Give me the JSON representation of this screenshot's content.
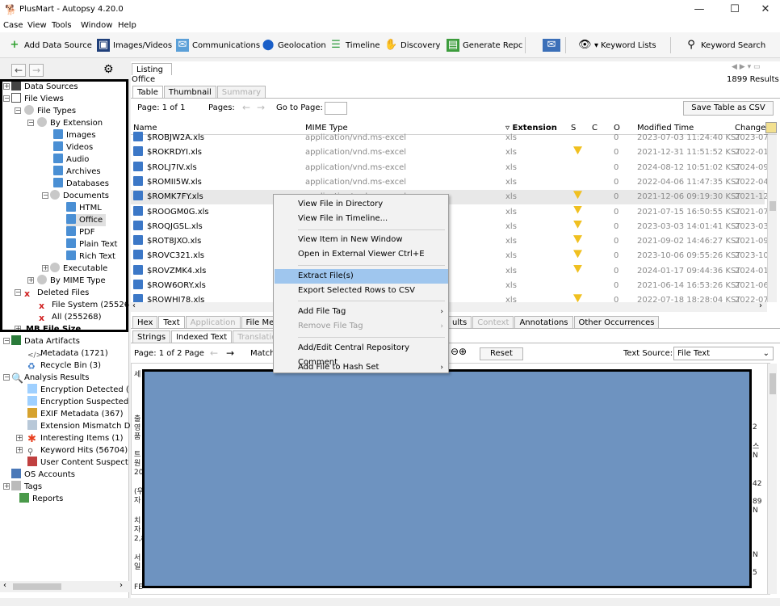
{
  "window": {
    "title": "PlusMart - Autopsy 4.20.0",
    "minimize": "—",
    "maximize": "☐",
    "close": "✕"
  },
  "menu": [
    "Case",
    "View",
    "Tools",
    "Window",
    "Help"
  ],
  "toolbar": {
    "add_data_source": "Add Data Source",
    "images_videos": "Images/Videos",
    "communications": "Communications",
    "geolocation": "Geolocation",
    "timeline": "Timeline",
    "discovery": "Discovery",
    "generate_report": "Generate Repc",
    "keyword_lists": "Keyword Lists",
    "keyword_search": "Keyword Search"
  },
  "tree": {
    "data_sources": "Data Sources",
    "file_views": "File Views",
    "file_types": "File Types",
    "by_extension": "By Extension",
    "images": "Images",
    "videos": "Videos",
    "audio": "Audio",
    "archives": "Archives",
    "databases": "Databases",
    "documents": "Documents",
    "html": "HTML",
    "office": "Office",
    "pdf": "PDF",
    "plain_text": "Plain Text",
    "rich_text": "Rich Text",
    "executable": "Executable",
    "by_mime_type": "By MIME Type",
    "deleted_files": "Deleted Files",
    "file_system": "File System (25526",
    "all": "All (255268)",
    "mb_file_size": "MB File Size",
    "data_artifacts": "Data Artifacts",
    "metadata": "Metadata (1721)",
    "recycle_bin": "Recycle Bin (3)",
    "analysis_results": "Analysis Results",
    "encryption_detected": "Encryption Detected (",
    "encryption_suspected": "Encryption Suspected",
    "exif_metadata": "EXIF Metadata (367)",
    "extension_mismatch": "Extension Mismatch D",
    "interesting_items": "Interesting Items (1)",
    "keyword_hits": "Keyword Hits (56704)",
    "user_content": "User Content Suspect",
    "os_accounts": "OS Accounts",
    "tags": "Tags",
    "reports": "Reports"
  },
  "listing": {
    "tab": "Listing",
    "subtitle": "Office",
    "results": "1899 Results",
    "view_tabs": [
      "Table",
      "Thumbnail",
      "Summary"
    ],
    "page": "Page: 1 of 1",
    "pages_label": "Pages:",
    "goto": "Go to Page:",
    "save_csv": "Save Table as CSV",
    "columns": {
      "name": "Name",
      "mime": "MIME Type",
      "ext": "Extension",
      "s": "S",
      "c": "C",
      "o": "O",
      "modified": "Modified Time",
      "change": "Change"
    },
    "rows": [
      {
        "name": "$ROBJW2A.xls",
        "mime": "application/vnd.ms-excel",
        "ext": "xls",
        "warn": false,
        "o": "0",
        "mod": "2023-07-03 11:24:40 KST",
        "chg": "2023-07-"
      },
      {
        "name": "$ROKRDYI.xls",
        "mime": "application/vnd.ms-excel",
        "ext": "xls",
        "warn": true,
        "o": "0",
        "mod": "2021-12-31 11:51:52 KST",
        "chg": "2022-01-"
      },
      {
        "name": "$ROLJ7IV.xls",
        "mime": "application/vnd.ms-excel",
        "ext": "xls",
        "warn": false,
        "o": "0",
        "mod": "2024-08-12 10:51:02 KST",
        "chg": "2024-09-"
      },
      {
        "name": "$ROMII5W.xls",
        "mime": "application/vnd.ms-excel",
        "ext": "xls",
        "warn": false,
        "o": "0",
        "mod": "2022-04-06 11:47:35 KST",
        "chg": "2022-04-"
      },
      {
        "name": "$ROMK7FY.xls",
        "mime": "application/vnd.ms-excel",
        "ext": "xls",
        "warn": true,
        "o": "0",
        "mod": "2021-12-06 09:19:30 KST",
        "chg": "2021-12-"
      },
      {
        "name": "$ROOGM0G.xls",
        "mime": "",
        "ext": "xls",
        "warn": true,
        "o": "0",
        "mod": "2021-07-15 16:50:55 KST",
        "chg": "2021-07-"
      },
      {
        "name": "$ROQJGSL.xls",
        "mime": "",
        "ext": "xls",
        "warn": true,
        "o": "0",
        "mod": "2023-03-03 14:01:41 KST",
        "chg": "2023-03-"
      },
      {
        "name": "$ROT8JXO.xls",
        "mime": "",
        "ext": "xls",
        "warn": true,
        "o": "0",
        "mod": "2021-09-02 14:46:27 KST",
        "chg": "2021-09-"
      },
      {
        "name": "$ROVC321.xls",
        "mime": "",
        "ext": "xls",
        "warn": true,
        "o": "0",
        "mod": "2023-10-06 09:55:26 KST",
        "chg": "2023-10-"
      },
      {
        "name": "$ROVZMK4.xls",
        "mime": "",
        "ext": "xls",
        "warn": true,
        "o": "0",
        "mod": "2024-01-17 09:44:36 KST",
        "chg": "2024-01-"
      },
      {
        "name": "$ROW6ORY.xls",
        "mime": "",
        "ext": "xls",
        "warn": false,
        "o": "0",
        "mod": "2021-06-14 16:53:26 KST",
        "chg": "2021-06-"
      },
      {
        "name": "$ROWHI78.xls",
        "mime": "",
        "ext": "xls",
        "warn": true,
        "o": "0",
        "mod": "2022-07-18 18:28:04 KST",
        "chg": "2022-07-"
      }
    ]
  },
  "context_menu": {
    "view_dir": "View File in Directory",
    "view_timeline": "View File in Timeline...",
    "view_new_window": "View Item in New Window",
    "open_external": "Open in External Viewer  Ctrl+E",
    "extract": "Extract File(s)",
    "export_csv": "Export Selected Rows to CSV",
    "add_tag": "Add File Tag",
    "remove_tag": "Remove File Tag",
    "add_comment": "Add/Edit Central Repository Comment",
    "add_hash": "Add File to Hash Set"
  },
  "bottom": {
    "tabs": [
      "Hex",
      "Text",
      "Application",
      "File Metada"
    ],
    "tabs_right": [
      "ults",
      "Context",
      "Annotations",
      "Other Occurrences"
    ],
    "subtabs": [
      "Strings",
      "Indexed Text",
      "Translation"
    ],
    "page": "Page: 1 of 2 Page",
    "match": "Match",
    "reset": "Reset",
    "text_source_label": "Text Source:",
    "text_source_value": "File Text",
    "footer_text": "FE"
  }
}
